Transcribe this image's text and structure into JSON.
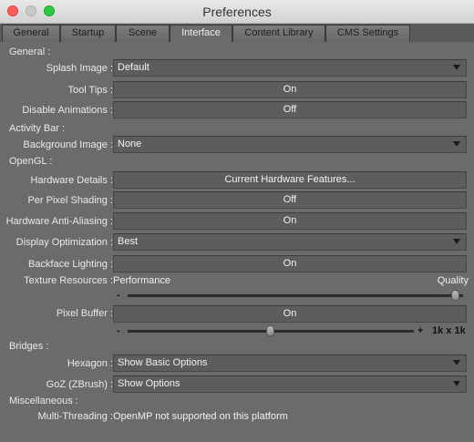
{
  "window": {
    "title": "Preferences"
  },
  "tabs": [
    {
      "label": "General"
    },
    {
      "label": "Startup"
    },
    {
      "label": "Scene"
    },
    {
      "label": "Interface"
    },
    {
      "label": "Content Library"
    },
    {
      "label": "CMS Settings"
    }
  ],
  "active_tab": "Interface",
  "sections": {
    "general": "General :",
    "activity_bar": "Activity Bar :",
    "opengl": "OpenGL :",
    "bridges": "Bridges :",
    "misc": "Miscellaneous :"
  },
  "general": {
    "splash_image": {
      "label": "Splash Image :",
      "value": "Default"
    },
    "tool_tips": {
      "label": "Tool Tips :",
      "value": "On"
    },
    "disable_animations": {
      "label": "Disable Animations :",
      "value": "Off"
    }
  },
  "activity_bar": {
    "background_image": {
      "label": "Background Image :",
      "value": "None"
    }
  },
  "opengl": {
    "hardware_details": {
      "label": "Hardware Details :",
      "value": "Current Hardware Features..."
    },
    "per_pixel_shading": {
      "label": "Per Pixel Shading :",
      "value": "Off"
    },
    "hardware_aa": {
      "label": "Hardware Anti-Aliasing :",
      "value": "On"
    },
    "display_optimization": {
      "label": "Display Optimization :",
      "value": "Best"
    },
    "backface_lighting": {
      "label": "Backface Lighting :",
      "value": "On"
    },
    "texture_resources": {
      "label": "Texture Resources :",
      "left_text": "Performance",
      "right_text": "Quality",
      "minus": "-",
      "position": 1.0
    },
    "pixel_buffer": {
      "label": "Pixel Buffer :",
      "value": "On",
      "minus": "-",
      "plus": "+",
      "size_text": "1k x 1k",
      "position": 0.5
    }
  },
  "bridges": {
    "hexagon": {
      "label": "Hexagon :",
      "value": "Show Basic Options"
    },
    "goz": {
      "label": "GoZ (ZBrush) :",
      "value": "Show Options"
    }
  },
  "misc": {
    "multi_threading": {
      "label": "Multi-Threading :",
      "value": "OpenMP not supported on this platform"
    }
  }
}
